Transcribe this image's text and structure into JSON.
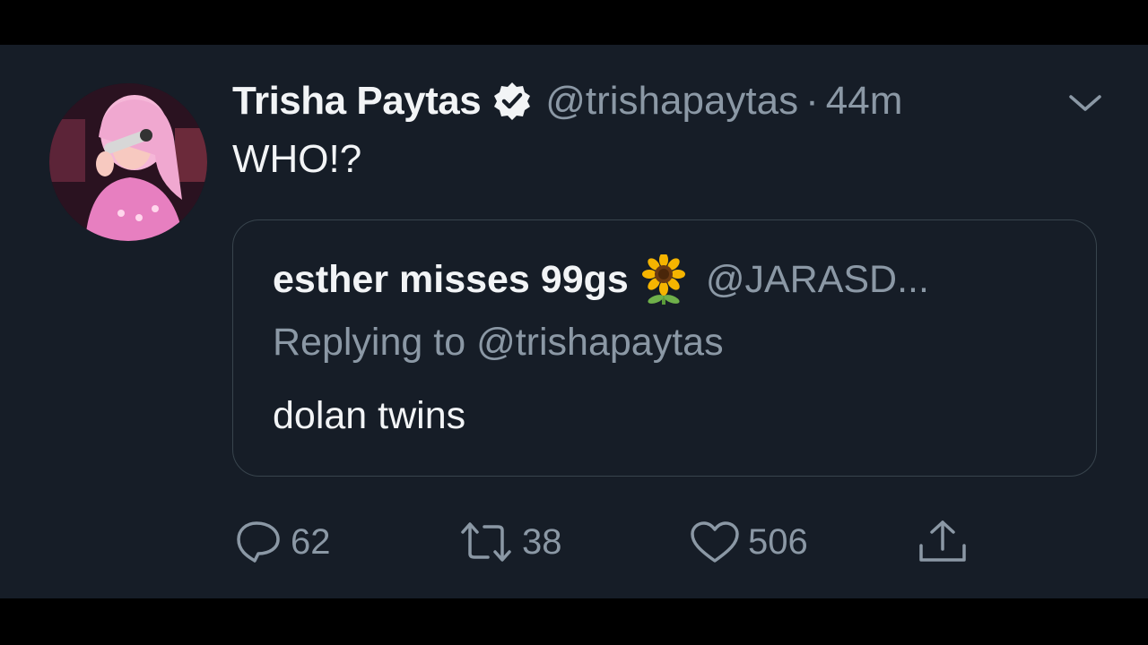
{
  "tweet": {
    "display_name": "Trisha Paytas",
    "handle": "@trishapaytas",
    "separator": "·",
    "time": "44m",
    "text": "WHO!?",
    "avatar_icon": "profile-photo",
    "verified_icon": "verified-badge-icon"
  },
  "quoted_tweet": {
    "display_name": "esther misses 99gs",
    "emoji_icon": "sunflower-emoji",
    "handle": "@JARASD...",
    "replying_to": "Replying to @trishapaytas",
    "text": "dolan twins"
  },
  "actions": {
    "replies": "62",
    "retweets": "38",
    "likes": "506"
  },
  "colors": {
    "background": "#161d27",
    "primary_text": "#f2f4f6",
    "secondary_text": "#8b98a5",
    "border": "#38444d"
  }
}
